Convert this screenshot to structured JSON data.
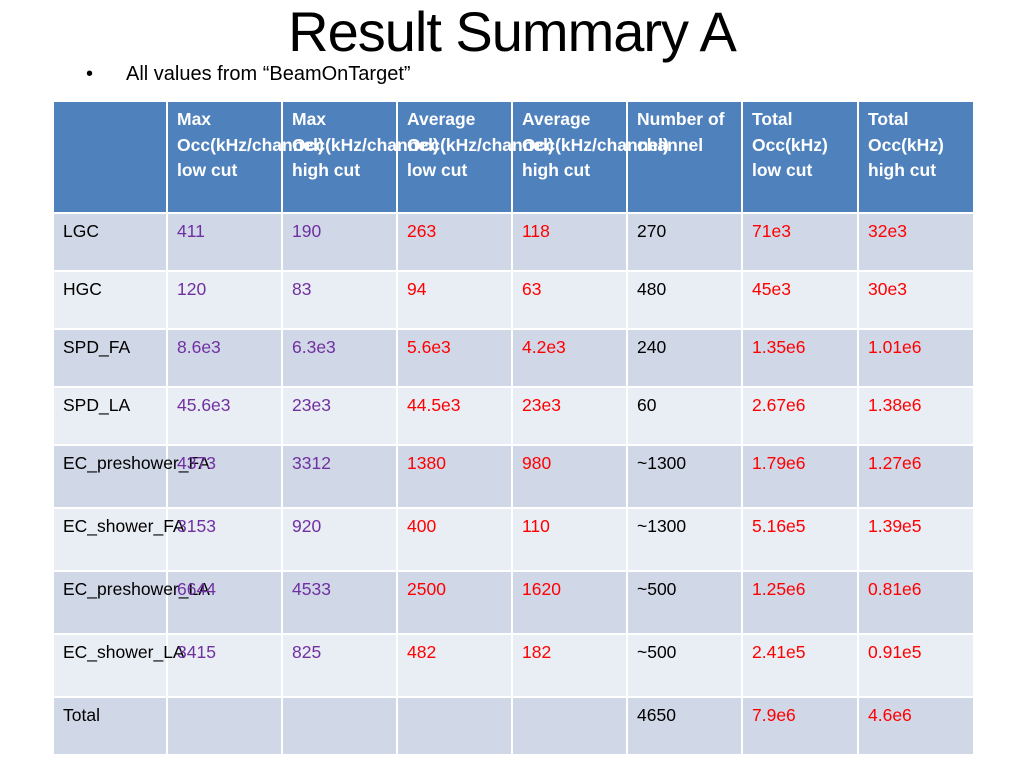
{
  "slide": {
    "title": "Result Summary A",
    "bullet_symbol": "•",
    "bullet_text": "All values from “BeamOnTarget”"
  },
  "colors": {
    "header_bg": "#4f81bd",
    "row_odd_bg": "#d0d8e8",
    "row_even_bg": "#e9edf4",
    "max_occ_text": "#7030a0",
    "avg_total_text": "#ff0000",
    "channel_text": "#000000"
  },
  "table": {
    "headers": [
      "",
      "Max Occ(kHz/channel) low cut",
      "Max Occ(kHz/channel) high cut",
      "Average Occ(kHz/channel) low cut",
      "Average Occ(kHz/channel) high cut",
      "Number of channel",
      "Total Occ(kHz) low cut",
      "Total Occ(kHz) high cut"
    ],
    "rows": [
      {
        "label": "LGC",
        "max_low": "411",
        "max_high": "190",
        "avg_low": "263",
        "avg_high": "118",
        "channels": "270",
        "total_low": "71e3",
        "total_high": "32e3"
      },
      {
        "label": "HGC",
        "max_low": "120",
        "max_high": "83",
        "avg_low": "94",
        "avg_high": "63",
        "channels": "480",
        "total_low": "45e3",
        "total_high": "30e3"
      },
      {
        "label": "SPD_FA",
        "max_low": "8.6e3",
        "max_high": "6.3e3",
        "avg_low": "5.6e3",
        "avg_high": "4.2e3",
        "channels": "240",
        "total_low": "1.35e6",
        "total_high": "1.01e6"
      },
      {
        "label": "SPD_LA",
        "max_low": "45.6e3",
        "max_high": "23e3",
        "avg_low": "44.5e3",
        "avg_high": "23e3",
        "channels": "60",
        "total_low": "2.67e6",
        "total_high": "1.38e6"
      },
      {
        "label": "EC_preshower_FA",
        "max_low": "4373",
        "max_high": "3312",
        "avg_low": "1380",
        "avg_high": "980",
        "channels": "~1300",
        "total_low": "1.79e6",
        "total_high": "1.27e6"
      },
      {
        "label": "EC_shower_FA",
        "max_low": "3153",
        "max_high": "920",
        "avg_low": "400",
        "avg_high": "110",
        "channels": "~1300",
        "total_low": "5.16e5",
        "total_high": "1.39e5"
      },
      {
        "label": "EC_preshower_LA",
        "max_low": "6644",
        "max_high": "4533",
        "avg_low": "2500",
        "avg_high": "1620",
        "channels": "~500",
        "total_low": "1.25e6",
        "total_high": "0.81e6"
      },
      {
        "label": "EC_shower_LA",
        "max_low": "3415",
        "max_high": "825",
        "avg_low": "482",
        "avg_high": "182",
        "channels": "~500",
        "total_low": "2.41e5",
        "total_high": "0.91e5"
      },
      {
        "label": "Total",
        "max_low": "",
        "max_high": "",
        "avg_low": "",
        "avg_high": "",
        "channels": "4650",
        "total_low": "7.9e6",
        "total_high": "4.6e6"
      }
    ]
  }
}
